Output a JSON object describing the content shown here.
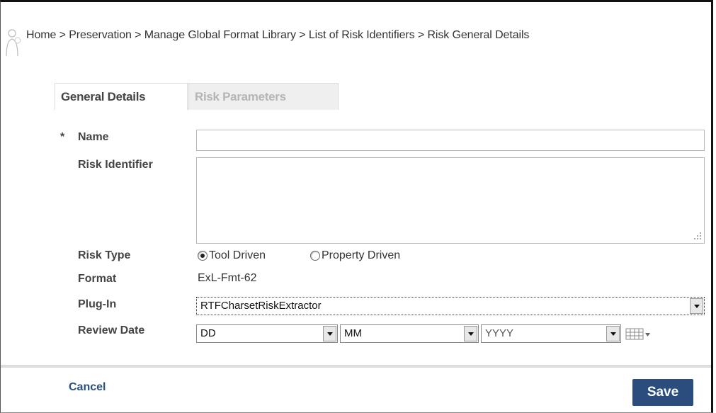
{
  "breadcrumb": {
    "text": "Home > Preservation > Manage Global Format Library > List of Risk Identifiers > Risk General Details"
  },
  "tabs": [
    {
      "label": "General Details"
    },
    {
      "label": "Risk Parameters"
    }
  ],
  "form": {
    "required_marker": "*",
    "name": {
      "label": "Name",
      "value": ""
    },
    "risk_identifier": {
      "label": "Risk Identifier",
      "value": ""
    },
    "risk_type": {
      "label": "Risk Type",
      "options": [
        "Tool Driven",
        "Property Driven"
      ],
      "selected": "Tool Driven"
    },
    "format": {
      "label": "Format",
      "value": "ExL-Fmt-62"
    },
    "plugin": {
      "label": "Plug-In",
      "value": "RTFCharsetRiskExtractor"
    },
    "review_date": {
      "label": "Review Date",
      "day": "DD",
      "month": "MM",
      "year": "YYYY"
    }
  },
  "footer": {
    "cancel_label": "Cancel",
    "save_label": "Save"
  },
  "colors": {
    "save_bg": "#2b4d7d",
    "link": "#2b4f7a"
  }
}
